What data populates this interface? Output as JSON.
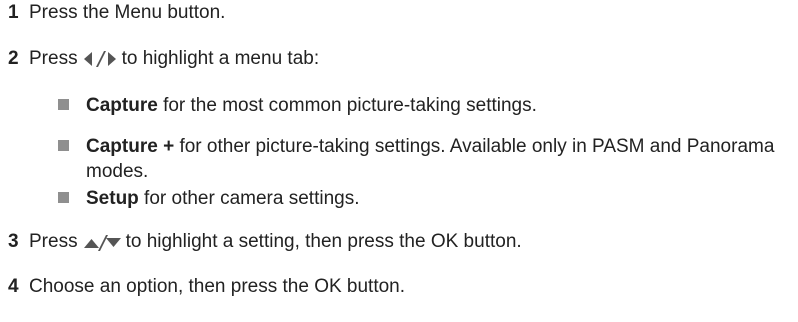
{
  "steps": [
    {
      "num": "1",
      "text": "Press the Menu button."
    },
    {
      "num": "2",
      "before": "Press",
      "after": "to highlight a menu tab:"
    },
    {
      "num": "3",
      "before": "Press",
      "after": "to highlight a setting, then press the OK button."
    },
    {
      "num": "4",
      "text": "Choose an option, then press the OK button."
    }
  ],
  "bullets": [
    {
      "term": "Capture",
      "text": " for the most common picture-taking settings."
    },
    {
      "term": "Capture +",
      "text": " for other picture-taking settings. Available only in PASM and Panorama modes."
    },
    {
      "term": "Setup",
      "text": " for other camera settings."
    }
  ],
  "icons": {
    "left_right": "left-right-arrow-icon",
    "up_down": "up-down-arrow-icon"
  },
  "colors": {
    "text": "#222222",
    "bullet": "#8f8f8f",
    "icon": "#555555"
  }
}
